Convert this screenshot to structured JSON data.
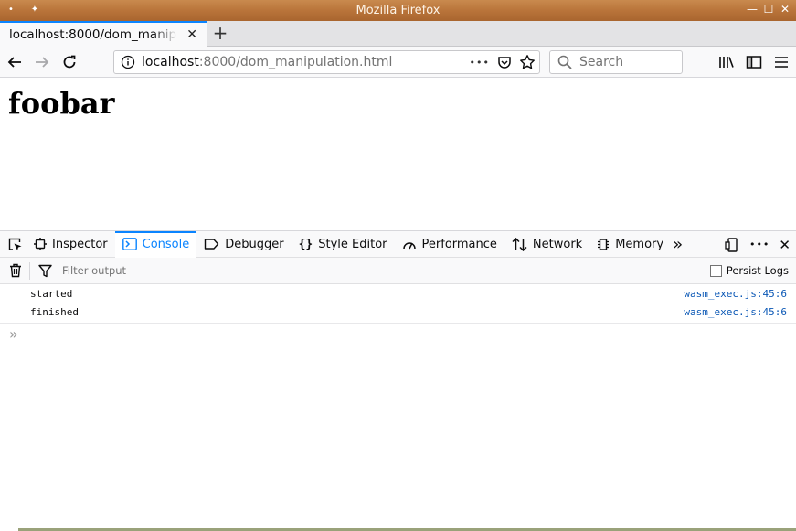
{
  "window": {
    "title": "Mozilla Firefox",
    "minimize_glyph": "—",
    "maximize_glyph": "☐",
    "close_glyph": "✕"
  },
  "tab": {
    "title": "localhost:8000/dom_manipulation.html",
    "close_glyph": "✕",
    "new_tab_glyph": "+"
  },
  "navbar": {
    "url_host": "localhost",
    "url_rest": ":8000/dom_manipulation.html",
    "more_glyph": "•••",
    "search_placeholder": "Search"
  },
  "page": {
    "heading": "foobar"
  },
  "devtools": {
    "tabs": [
      {
        "label": "Inspector"
      },
      {
        "label": "Console"
      },
      {
        "label": "Debugger"
      },
      {
        "label": "Style Editor"
      },
      {
        "label": "Performance"
      },
      {
        "label": "Network"
      },
      {
        "label": "Memory"
      }
    ],
    "overflow_glyph": "»",
    "more_glyph": "•••",
    "close_glyph": "✕",
    "filter_placeholder": "Filter output",
    "persist_label": "Persist Logs",
    "messages": [
      {
        "text": "started",
        "location": "wasm_exec.js:45:6"
      },
      {
        "text": "finished",
        "location": "wasm_exec.js:45:6"
      }
    ],
    "prompt_glyph": "»"
  },
  "colors": {
    "accent": "#0a84ff",
    "titlebar": "#b9743a",
    "link": "#0a57b5"
  }
}
